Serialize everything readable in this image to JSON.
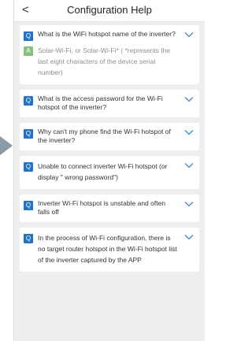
{
  "header": {
    "back_glyph": "<",
    "title": "Configuration Help"
  },
  "items": [
    {
      "question": "What is the WiFi hotspot name of the inverter?",
      "answer": "Solar-Wi-Fi, or Solar-Wi-Fi* ( *represents the last eight characters of the device serial number)",
      "expanded": true
    },
    {
      "question": "What is the access password for the Wi-Fi hotspot of the inverter?"
    },
    {
      "question": "Why can't my phone find the Wi-Fi hotspot of the inverter?"
    },
    {
      "question": "Unable to connect inverter Wi-Fi hotspot (or display \" wrong password\")"
    },
    {
      "question": "Inverter Wi-Fi hotspot is unstable and often falls off"
    },
    {
      "question": "In the process of Wi-Fi configuration, there is no target router hotspot in the Wi-Fi hotspot list of the inverter captured by the APP"
    }
  ],
  "badges": {
    "question": "Q",
    "answer": "A"
  },
  "colors": {
    "question_badge": "#1f74c9",
    "answer_badge": "#86c27a",
    "chevron": "#3d86d6",
    "pointer_arrow": "#8a9aa6"
  }
}
